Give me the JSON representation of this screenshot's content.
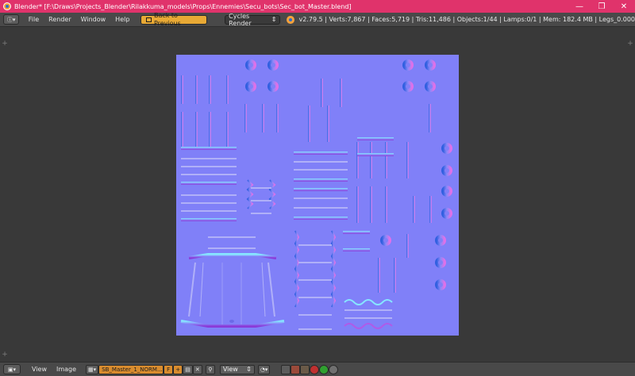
{
  "window": {
    "title": "Blender* [F:\\Draws\\Projects_Blender\\Rilakkuma_models\\Props\\Ennemies\\Secu_bots\\Sec_bot_Master.blend]",
    "minimize_glyph": "—",
    "maximize_glyph": "❐",
    "close_glyph": "✕"
  },
  "topbar": {
    "editor_type_glyph": "ⓘ▾",
    "menus": [
      "File",
      "Render",
      "Window",
      "Help"
    ],
    "back_button": "Back to Previous",
    "render_engine": "Cycles Render",
    "stats": "v2.79.5 | Verts:7,867 | Faces:5,719 | Tris:11,486 | Objects:1/44 | Lamps:0/1 | Mem: 182.4 MB | Legs_0.000"
  },
  "bottombar": {
    "editor_type_glyph": "▣▾",
    "menus": [
      "View",
      "Image"
    ],
    "image_browse_glyph": "▦▾",
    "image_name": "SB_Master_1_NORM...",
    "fake_user": "F",
    "new_glyph": "+",
    "open_glyph": "▤",
    "unlink_glyph": "✕",
    "pin_glyph": "⚲",
    "mode": "View",
    "pivot_glyph": "◔▾"
  },
  "colors": {
    "title_bar": "#e0336b",
    "header_bg": "#494949",
    "editor_bg": "#393939",
    "normal_map_base": "#8080f8",
    "accent": "#e8a935"
  }
}
